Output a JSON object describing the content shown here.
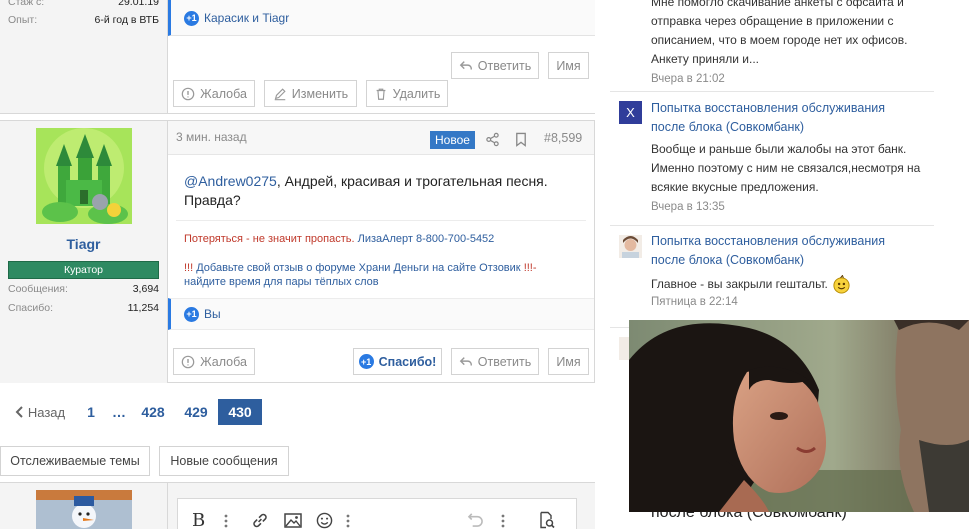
{
  "post1": {
    "stats": [
      {
        "label": "Стаж с:",
        "value": "29.01.19"
      },
      {
        "label": "Опыт:",
        "value": "6-й год в ВТБ"
      }
    ],
    "likes_text": "Карасик и Tiagr",
    "reply_label": "Ответить",
    "name_label": "Имя",
    "complain_label": "Жалоба",
    "edit_label": "Изменить",
    "delete_label": "Удалить"
  },
  "post2": {
    "username": "Tiagr",
    "role": "Куратор",
    "stats": [
      {
        "label": "Сообщения:",
        "value": "3,694"
      },
      {
        "label": "Спасибо:",
        "value": "11,254"
      }
    ],
    "time": "3 мин. назад",
    "new_badge": "Новое",
    "post_number": "#8,599",
    "mention": "@Andrew0275",
    "body_rest": ", Андрей, красивая и трогательная песня.",
    "body_line2": "Правда?",
    "sig_red": "Потеряться - не значит пропасть.",
    "sig_link1": "ЛизаАлерт 8-800-700-5452",
    "sig2_red1": "!!!",
    "sig2_link": "Добавьте свой отзыв о форуме Храни Деньги на сайте Отзовик",
    "sig2_red2": "!!!-",
    "sig2_line2": "найдите время для пары тёплых слов",
    "likes_text": "Вы",
    "complain_label": "Жалоба",
    "thanks_label": "Спасибо!",
    "reply_label": "Ответить",
    "name_label": "Имя"
  },
  "pager": {
    "prev_label": "Назад",
    "pages": [
      "1",
      "…",
      "428",
      "429",
      "430"
    ],
    "current": "430"
  },
  "actions": {
    "watched_label": "Отслеживаемые темы",
    "new_messages_label": "Новые сообщения"
  },
  "feed": {
    "item0": {
      "lines": [
        "Мне помогло скачивание анкеты с офсайта и",
        "отправка через обращение в приложении с",
        "описанием, что в моем городе нет их офисов.",
        "Анкету приняли и..."
      ],
      "time": "Вчера в 21:02"
    },
    "item1": {
      "avatar_letter": "X",
      "title1": "Попытка восстановления обслуживания",
      "title2": "после блока (Совкомбанк)",
      "lines": [
        "Вообще и раньше были жалобы на этот банк.",
        "Именно поэтому с ним не связался,несмотря на",
        "всякие вкусные предложения."
      ],
      "time": "Вчера в 13:35"
    },
    "item2": {
      "title1": "Попытка восстановления обслуживания",
      "title2": "после блока (Совкомбанк)",
      "text": "Главное - вы закрыли гештальт.",
      "time": "Пятница в 22:14"
    },
    "item3": {
      "title2": "после блока (Совкомбанк)"
    }
  },
  "colors": {
    "link": "#2e5e9e",
    "badge_blue": "#3478c6",
    "role_green": "#2e8a62",
    "red_text": "#c0392b"
  }
}
